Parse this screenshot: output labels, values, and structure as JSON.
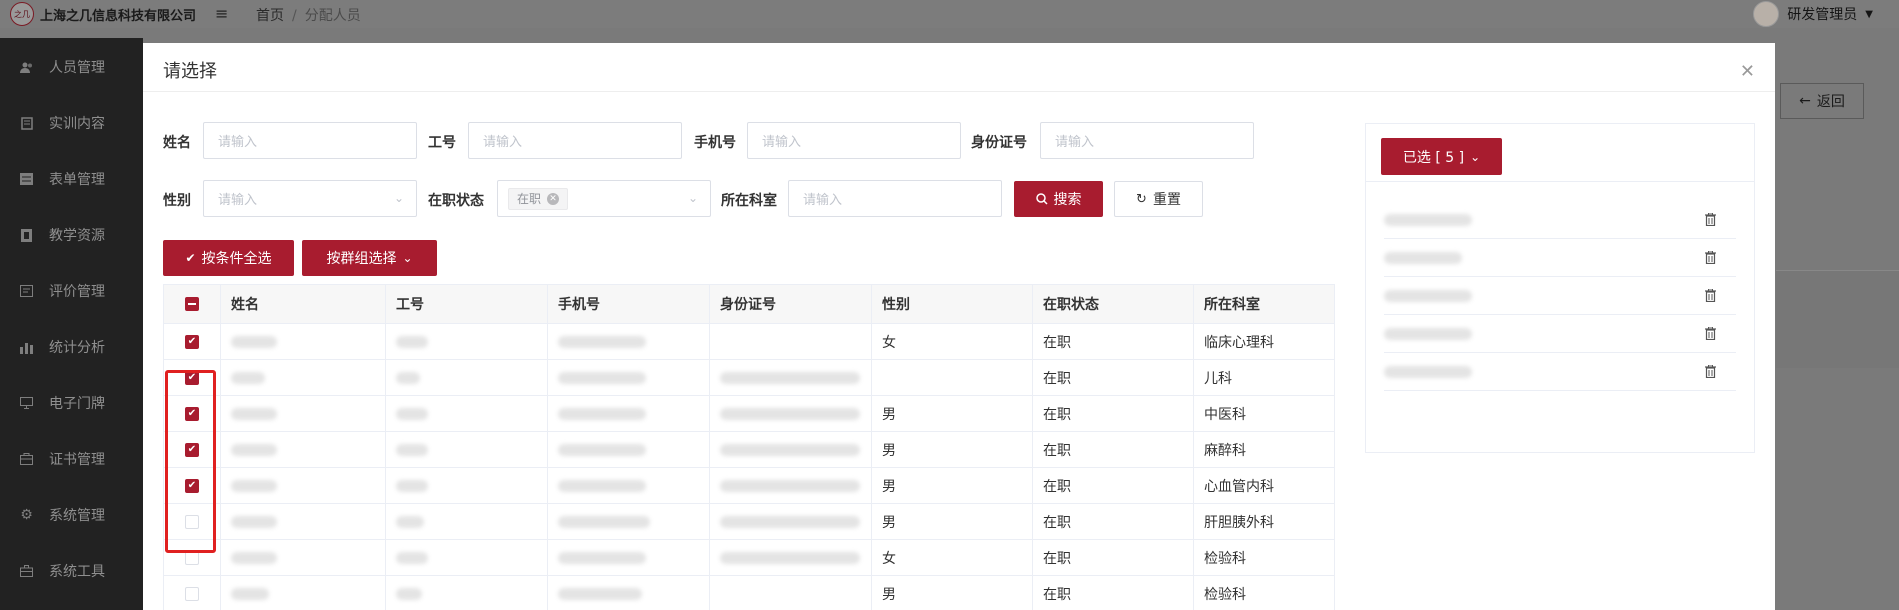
{
  "app": {
    "company": "上海之几信息科技有限公司",
    "logo_mark": "之几",
    "breadcrumb": [
      "首页",
      "分配人员"
    ],
    "breadcrumb_sep": "/",
    "user": "研发管理员",
    "back_label": "返回"
  },
  "sidebar": {
    "items": [
      {
        "label": "人员管理",
        "icon": "users-icon"
      },
      {
        "label": "实训内容",
        "icon": "book-icon"
      },
      {
        "label": "表单管理",
        "icon": "form-icon"
      },
      {
        "label": "教学资源",
        "icon": "resource-icon"
      },
      {
        "label": "评价管理",
        "icon": "review-icon"
      },
      {
        "label": "统计分析",
        "icon": "bar-chart-icon"
      },
      {
        "label": "电子门牌",
        "icon": "monitor-icon"
      },
      {
        "label": "证书管理",
        "icon": "certificate-icon"
      },
      {
        "label": "系统管理",
        "icon": "gear-icon"
      },
      {
        "label": "系统工具",
        "icon": "toolbox-icon"
      }
    ]
  },
  "dialog": {
    "title": "请选择",
    "filters": {
      "name_label": "姓名",
      "name_placeholder": "请输入",
      "id_label": "工号",
      "id_placeholder": "请输入",
      "phone_label": "手机号",
      "phone_placeholder": "请输入",
      "card_label": "身份证号",
      "card_placeholder": "请输入",
      "sex_label": "性别",
      "sex_placeholder": "请输入",
      "status_label": "在职状态",
      "status_tag": "在职",
      "dept_label": "所在科室",
      "dept_placeholder": "请输入",
      "search_label": "搜索",
      "reset_label": "重置"
    },
    "actions": {
      "select_all_label": "按条件全选",
      "group_label": "按群组选择"
    },
    "table": {
      "columns": [
        "姓名",
        "工号",
        "手机号",
        "身份证号",
        "性别",
        "在职状态",
        "所在科室"
      ],
      "rows": [
        {
          "checked": true,
          "sex": "女",
          "status": "在职",
          "dept": "临床心理科",
          "has_card": false
        },
        {
          "checked": true,
          "sex": "",
          "status": "在职",
          "dept": "儿科",
          "has_card": true
        },
        {
          "checked": true,
          "sex": "男",
          "status": "在职",
          "dept": "中医科",
          "has_card": true
        },
        {
          "checked": true,
          "sex": "男",
          "status": "在职",
          "dept": "麻醉科",
          "has_card": true
        },
        {
          "checked": true,
          "sex": "男",
          "status": "在职",
          "dept": "心血管内科",
          "has_card": true
        },
        {
          "checked": false,
          "sex": "男",
          "status": "在职",
          "dept": "肝胆胰外科",
          "has_card": true
        },
        {
          "checked": false,
          "sex": "女",
          "status": "在职",
          "dept": "检验科",
          "has_card": true
        },
        {
          "checked": false,
          "sex": "男",
          "status": "在职",
          "dept": "检验科",
          "has_card": false
        }
      ]
    },
    "selected": {
      "label": "已选 [ 5 ]",
      "count": 5
    }
  },
  "colors": {
    "brand": "#a81c2f",
    "highlight": "#e02020"
  }
}
